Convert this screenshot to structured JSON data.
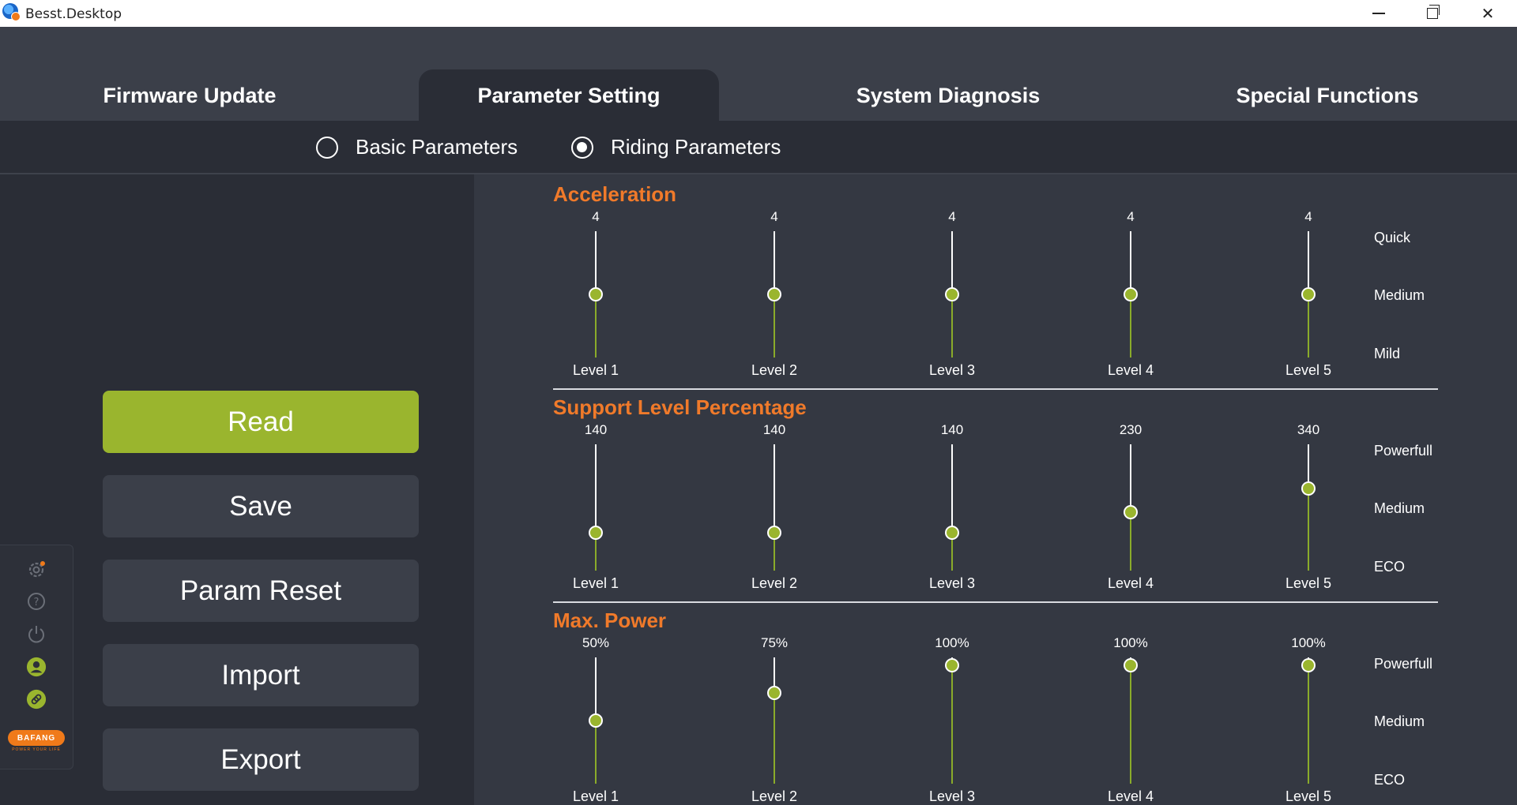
{
  "window": {
    "title": "Besst.Desktop"
  },
  "tabs": [
    {
      "label": "Firmware Update"
    },
    {
      "label": "Parameter Setting"
    },
    {
      "label": "System Diagnosis"
    },
    {
      "label": "Special Functions"
    }
  ],
  "subtabs": [
    {
      "label": "Basic Parameters",
      "selected": false
    },
    {
      "label": "Riding Parameters",
      "selected": true
    }
  ],
  "actions": {
    "read": "Read",
    "save": "Save",
    "reset": "Param Reset",
    "import": "Import",
    "export": "Export"
  },
  "sidebar": {
    "icons": [
      "settings-icon",
      "help-icon",
      "power-icon",
      "user-icon",
      "link-icon"
    ],
    "logo_text": "BAFANG",
    "logo_tagline": "POWER YOUR LIFE"
  },
  "colors": {
    "accent": "#9ab52e",
    "section_title": "#f07a2a",
    "brand": "#f07a1a"
  },
  "sections": [
    {
      "title": "Acceleration",
      "levels": [
        "Level 1",
        "Level 2",
        "Level 3",
        "Level 4",
        "Level 5"
      ],
      "values": [
        "4",
        "4",
        "4",
        "4",
        "4"
      ],
      "slider_fraction": [
        0.5,
        0.5,
        0.5,
        0.5,
        0.5
      ],
      "scale": [
        "Quick",
        "Medium",
        "Mild"
      ]
    },
    {
      "title": "Support Level Percentage",
      "levels": [
        "Level 1",
        "Level 2",
        "Level 3",
        "Level 4",
        "Level 5"
      ],
      "values": [
        "140",
        "140",
        "140",
        "230",
        "340"
      ],
      "slider_fraction": [
        0.3,
        0.3,
        0.3,
        0.46,
        0.65
      ],
      "scale": [
        "Powerfull",
        "Medium",
        "ECO"
      ]
    },
    {
      "title": "Max. Power",
      "levels": [
        "Level 1",
        "Level 2",
        "Level 3",
        "Level 4",
        "Level 5"
      ],
      "values": [
        "50%",
        "75%",
        "100%",
        "100%",
        "100%"
      ],
      "slider_fraction": [
        0.5,
        0.72,
        0.94,
        0.94,
        0.94
      ],
      "scale": [
        "Powerfull",
        "Medium",
        "ECO"
      ]
    }
  ]
}
